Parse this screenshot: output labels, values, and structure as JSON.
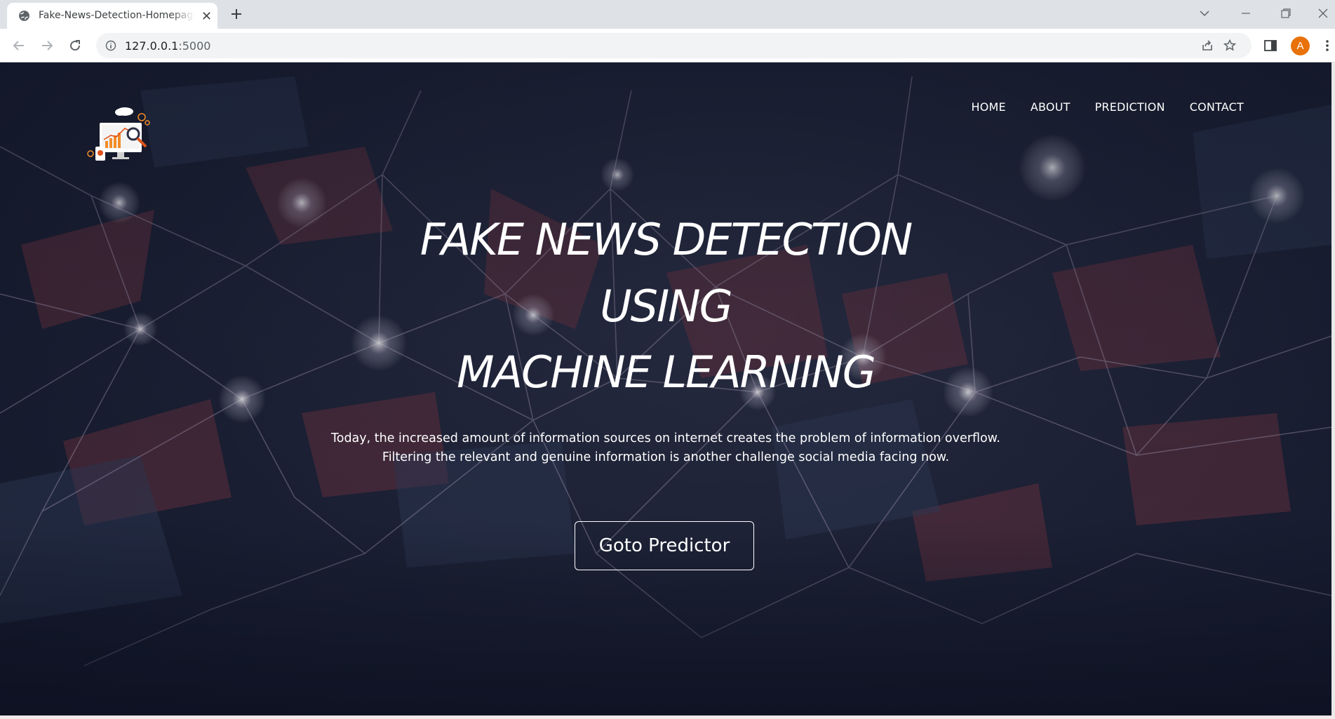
{
  "browser": {
    "tab_title": "Fake-News-Detection-Homepage",
    "url_host": "127.0.0.1",
    "url_port": ":5000",
    "profile_initial": "A"
  },
  "page": {
    "nav": [
      "HOME",
      "ABOUT",
      "PREDICTION",
      "CONTACT"
    ],
    "hero_lines": [
      "FAKE NEWS DETECTION",
      "USING",
      "MACHINE LEARNING"
    ],
    "description_lines": [
      "Today, the increased amount of information sources on internet creates the problem of information overflow.",
      "Filtering the relevant and genuine information is another challenge social media facing now."
    ],
    "cta_label": "Goto Predictor"
  },
  "colors": {
    "accent": "#e8710a",
    "page_background": "#1b2034",
    "network_red": "#8a3a44"
  },
  "icons": [
    "globe-icon",
    "close-icon",
    "plus-icon",
    "chevron-down-icon",
    "minimize-icon",
    "restore-icon",
    "back-icon",
    "forward-icon",
    "reload-icon",
    "info-icon",
    "share-icon",
    "star-icon",
    "sidepanel-icon",
    "kebab-icon"
  ]
}
